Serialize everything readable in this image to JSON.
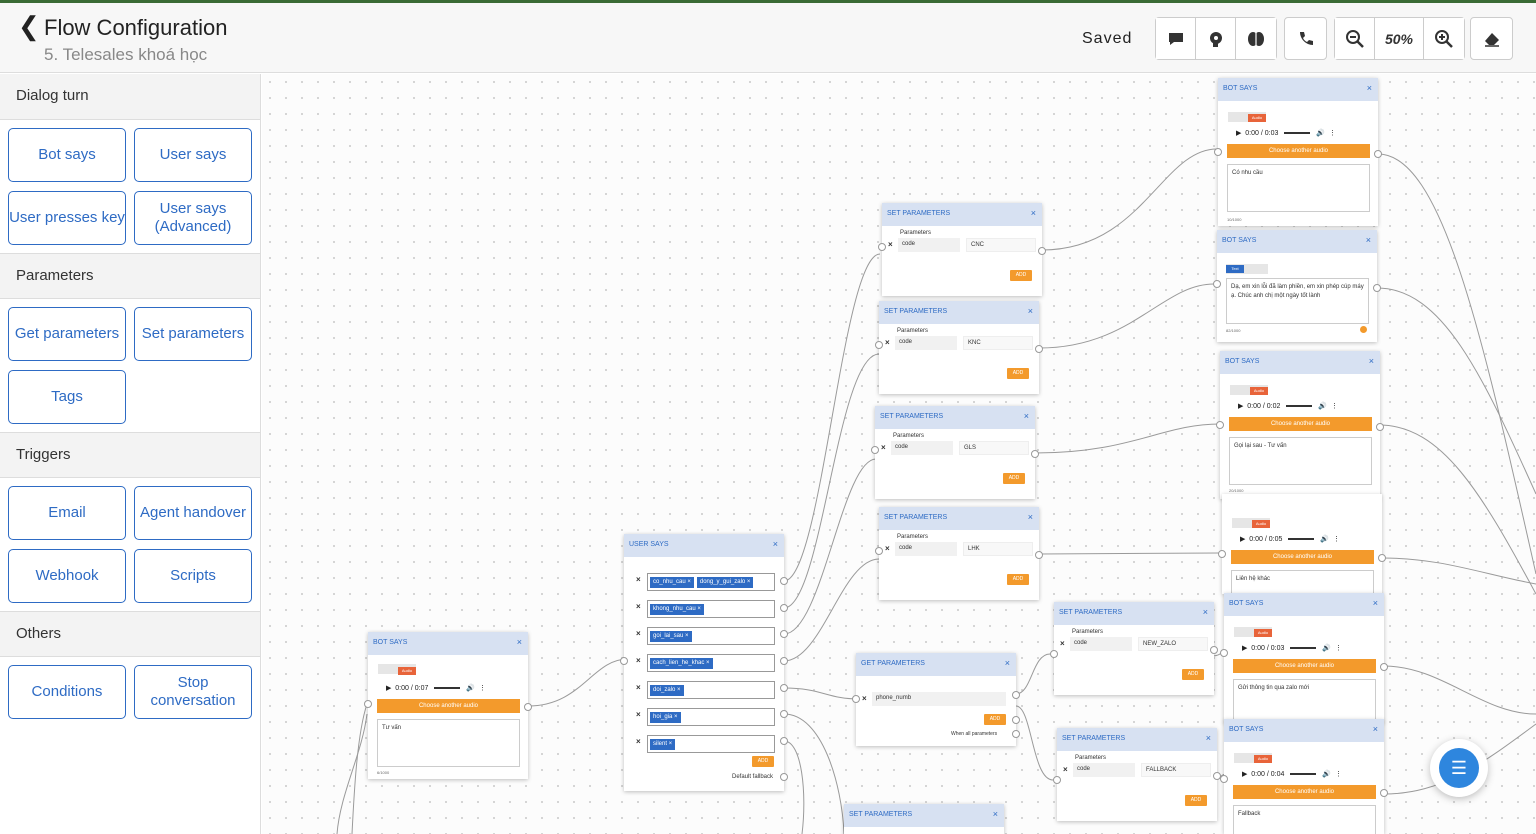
{
  "header": {
    "back_icon": "chevron-left-icon",
    "title": "Flow Configuration",
    "subtitle": "5. Telesales khoá học",
    "status": "Saved",
    "zoom": "50%"
  },
  "sidebar": {
    "sections": [
      {
        "title": "Dialog turn",
        "items": [
          "Bot says",
          "User says",
          "User presses key",
          "User says (Advanced)"
        ]
      },
      {
        "title": "Parameters",
        "items": [
          "Get parameters",
          "Set parameters",
          "Tags"
        ]
      },
      {
        "title": "Triggers",
        "items": [
          "Email",
          "Agent handover",
          "Webhook",
          "Scripts"
        ]
      },
      {
        "title": "Others",
        "items": [
          "Conditions",
          "Stop conversation"
        ]
      }
    ]
  },
  "canvas": {
    "bot_says_main": {
      "title": "BOT SAYS",
      "audio_tag": "Audio",
      "time": "0:00 / 0:07",
      "choose": "Choose another audio",
      "text": "Tư vấn",
      "count": "6/1000"
    },
    "user_says": {
      "title": "USER SAYS",
      "rows": [
        [
          "co_nhu_cau ×",
          "dong_y_gui_zalo ×"
        ],
        [
          "khong_nhu_cau ×"
        ],
        [
          "goi_lai_sau ×"
        ],
        [
          "cach_lien_he_khac ×"
        ],
        [
          "doi_zalo ×"
        ],
        [
          "hoi_gia ×"
        ],
        [
          "silent ×"
        ]
      ],
      "add": "ADD",
      "fallback": "Default fallback"
    },
    "set_params": [
      {
        "title": "SET PARAMETERS",
        "label": "Parameters",
        "key": "code",
        "value": "CNC",
        "add": "ADD"
      },
      {
        "title": "SET PARAMETERS",
        "label": "Parameters",
        "key": "code",
        "value": "KNC",
        "add": "ADD"
      },
      {
        "title": "SET PARAMETERS",
        "label": "Parameters",
        "key": "code",
        "value": "GLS",
        "add": "ADD"
      },
      {
        "title": "SET PARAMETERS",
        "label": "Parameters",
        "key": "code",
        "value": "LHK",
        "add": "ADD"
      },
      {
        "title": "SET PARAMETERS",
        "label": "Parameters",
        "key": "code",
        "value": "NEW_ZALO",
        "add": "ADD"
      },
      {
        "title": "SET PARAMETERS",
        "label": "Parameters",
        "key": "code",
        "value": "FALLBACK",
        "add": "ADD"
      },
      {
        "title": "SET PARAMETERS"
      }
    ],
    "get_params": {
      "title": "GET PARAMETERS",
      "param": "phone_numb",
      "add": "ADD",
      "footer": "When all parameters"
    },
    "bot_says_right": [
      {
        "title": "BOT SAYS",
        "audio_tag": "Audio",
        "time": "0:00 / 0:03",
        "choose": "Choose another audio",
        "text": "Có nhu cầu",
        "count": "10/1000"
      },
      {
        "title": "BOT SAYS",
        "audio_tag": "Text",
        "text": "Dạ, em xin lỗi đã làm phiền, em xin phép cúp máy ạ. Chúc anh chị một ngày tốt lành",
        "count": "82/1000"
      },
      {
        "title": "BOT SAYS",
        "audio_tag": "Audio",
        "time": "0:00 / 0:02",
        "choose": "Choose another audio",
        "text": "Gọi lại sau - Tư vấn",
        "count": "20/1000"
      },
      {
        "title": "BOT SAYS",
        "audio_tag": "Audio",
        "time": "0:00 / 0:05",
        "choose": "Choose another audio",
        "text": "Liên hệ khác"
      },
      {
        "title": "BOT SAYS",
        "audio_tag": "Audio",
        "time": "0:00 / 0:03",
        "choose": "Choose another audio",
        "text": "Gửi thông tin qua zalo mới"
      },
      {
        "title": "BOT SAYS",
        "audio_tag": "Audio",
        "time": "0:00 / 0:04",
        "choose": "Choose another audio",
        "text": "Fallback"
      }
    ]
  },
  "colors": {
    "accent": "#2e6bc4",
    "orange": "#f39a2c",
    "node_header": "#d7e1f2"
  }
}
